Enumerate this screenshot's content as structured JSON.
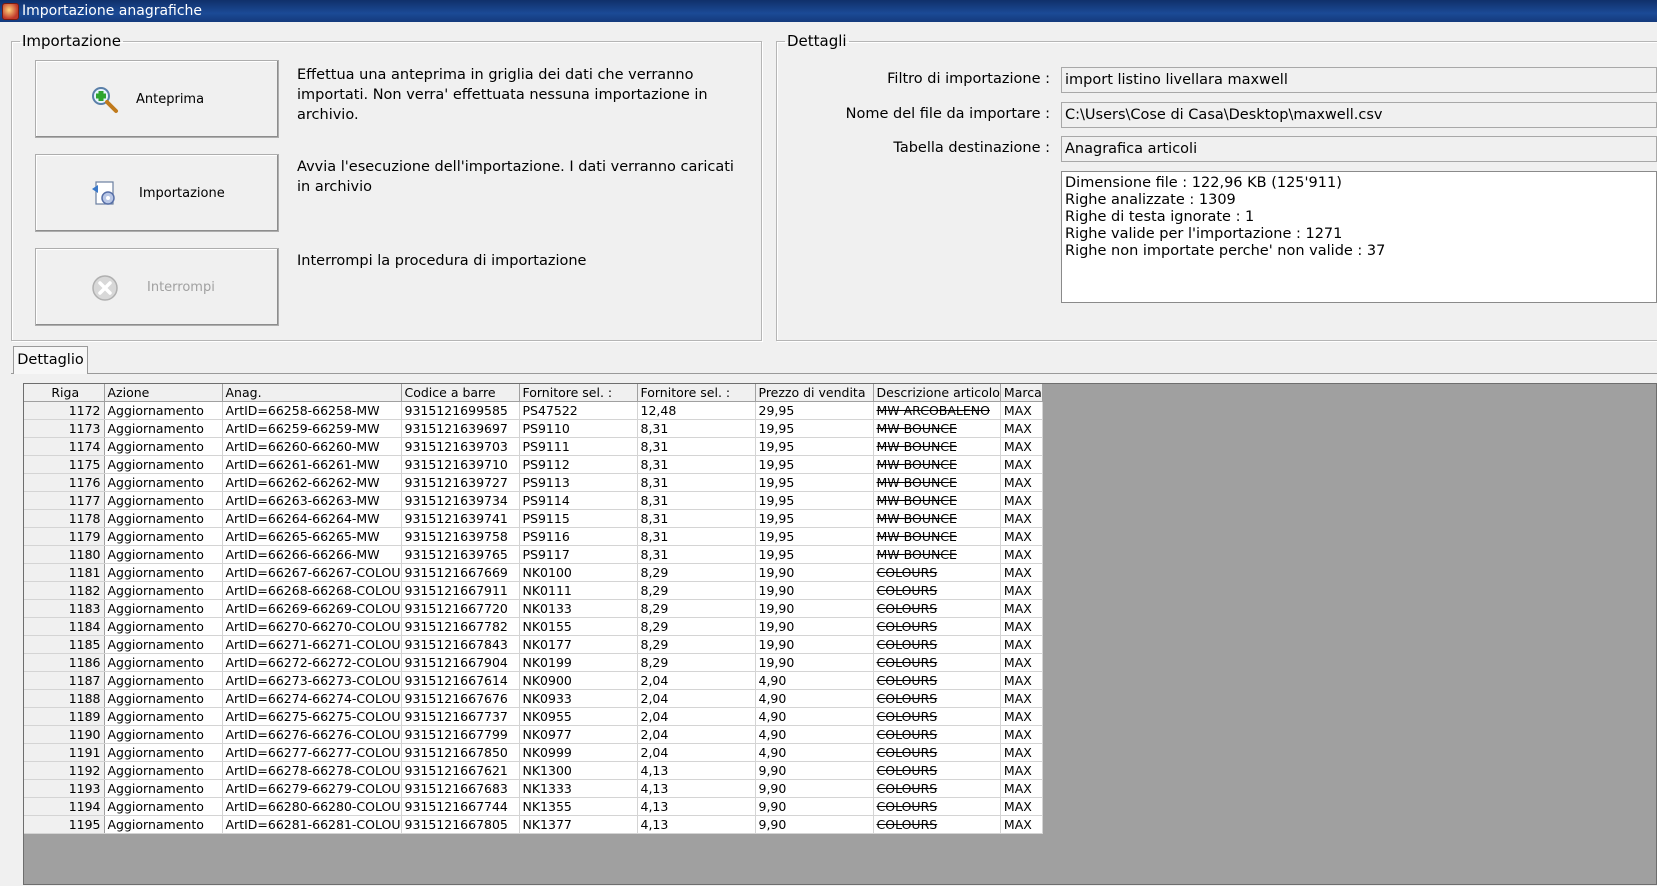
{
  "window": {
    "title": "Importazione anagrafiche"
  },
  "importazione": {
    "legend": "Importazione",
    "buttons": [
      {
        "label": "Anteprima",
        "icon": "magnifier-plus-icon",
        "enabled": true,
        "description": "Effettua una anteprima in griglia dei dati che verranno importati. Non verra' effettuata nessuna importazione in archivio."
      },
      {
        "label": "Importazione",
        "icon": "import-gear-icon",
        "enabled": true,
        "description": "Avvia l'esecuzione dell'importazione. I dati verranno caricati in archivio"
      },
      {
        "label": "Interrompi",
        "icon": "stop-x-icon",
        "enabled": false,
        "description": "Interrompi la procedura di importazione"
      }
    ]
  },
  "dettagli": {
    "legend": "Dettagli",
    "fields": [
      {
        "label": "Filtro di importazione :",
        "value": "import listino livellara maxwell"
      },
      {
        "label": "Nome del file da importare :",
        "value": "C:\\Users\\Cose di Casa\\Desktop\\maxwell.csv"
      },
      {
        "label": "Tabella destinazione :",
        "value": "Anagrafica articoli"
      }
    ],
    "info": [
      "Dimensione file : 122,96 KB (125'911)",
      "Righe analizzate : 1309",
      "Righe di testa ignorate : 1",
      "Righe valide per l'importazione : 1271",
      "Righe non importate perche' non valide : 37"
    ]
  },
  "tab": {
    "label": "Dettaglio"
  },
  "grid": {
    "columns": [
      "Riga",
      "Azione",
      "Anag.",
      "Codice a barre",
      "Fornitore sel. :",
      "Fornitore sel. :",
      "Prezzo di vendita",
      "Descrizione articolo",
      "Marca"
    ],
    "rows": [
      [
        "1172",
        "Aggiornamento",
        "ArtID=66258-66258-MW",
        "9315121699585",
        "PS47522",
        "12,48",
        "29,95",
        "MW ARCOBALENO",
        "MAX"
      ],
      [
        "1173",
        "Aggiornamento",
        "ArtID=66259-66259-MW",
        "9315121639697",
        "PS9110",
        "8,31",
        "19,95",
        "MW BOUNCE",
        "MAX"
      ],
      [
        "1174",
        "Aggiornamento",
        "ArtID=66260-66260-MW",
        "9315121639703",
        "PS9111",
        "8,31",
        "19,95",
        "MW BOUNCE",
        "MAX"
      ],
      [
        "1175",
        "Aggiornamento",
        "ArtID=66261-66261-MW",
        "9315121639710",
        "PS9112",
        "8,31",
        "19,95",
        "MW BOUNCE",
        "MAX"
      ],
      [
        "1176",
        "Aggiornamento",
        "ArtID=66262-66262-MW",
        "9315121639727",
        "PS9113",
        "8,31",
        "19,95",
        "MW BOUNCE",
        "MAX"
      ],
      [
        "1177",
        "Aggiornamento",
        "ArtID=66263-66263-MW",
        "9315121639734",
        "PS9114",
        "8,31",
        "19,95",
        "MW BOUNCE",
        "MAX"
      ],
      [
        "1178",
        "Aggiornamento",
        "ArtID=66264-66264-MW",
        "9315121639741",
        "PS9115",
        "8,31",
        "19,95",
        "MW BOUNCE",
        "MAX"
      ],
      [
        "1179",
        "Aggiornamento",
        "ArtID=66265-66265-MW",
        "9315121639758",
        "PS9116",
        "8,31",
        "19,95",
        "MW BOUNCE",
        "MAX"
      ],
      [
        "1180",
        "Aggiornamento",
        "ArtID=66266-66266-MW",
        "9315121639765",
        "PS9117",
        "8,31",
        "19,95",
        "MW BOUNCE",
        "MAX"
      ],
      [
        "1181",
        "Aggiornamento",
        "ArtID=66267-66267-COLOU",
        "9315121667669",
        "NK0100",
        "8,29",
        "19,90",
        "COLOURS",
        "MAX"
      ],
      [
        "1182",
        "Aggiornamento",
        "ArtID=66268-66268-COLOU",
        "9315121667911",
        "NK0111",
        "8,29",
        "19,90",
        "COLOURS",
        "MAX"
      ],
      [
        "1183",
        "Aggiornamento",
        "ArtID=66269-66269-COLOU",
        "9315121667720",
        "NK0133",
        "8,29",
        "19,90",
        "COLOURS",
        "MAX"
      ],
      [
        "1184",
        "Aggiornamento",
        "ArtID=66270-66270-COLOU",
        "9315121667782",
        "NK0155",
        "8,29",
        "19,90",
        "COLOURS",
        "MAX"
      ],
      [
        "1185",
        "Aggiornamento",
        "ArtID=66271-66271-COLOU",
        "9315121667843",
        "NK0177",
        "8,29",
        "19,90",
        "COLOURS",
        "MAX"
      ],
      [
        "1186",
        "Aggiornamento",
        "ArtID=66272-66272-COLOU",
        "9315121667904",
        "NK0199",
        "8,29",
        "19,90",
        "COLOURS",
        "MAX"
      ],
      [
        "1187",
        "Aggiornamento",
        "ArtID=66273-66273-COLOU",
        "9315121667614",
        "NK0900",
        "2,04",
        "4,90",
        "COLOURS",
        "MAX"
      ],
      [
        "1188",
        "Aggiornamento",
        "ArtID=66274-66274-COLOU",
        "9315121667676",
        "NK0933",
        "2,04",
        "4,90",
        "COLOURS",
        "MAX"
      ],
      [
        "1189",
        "Aggiornamento",
        "ArtID=66275-66275-COLOU",
        "9315121667737",
        "NK0955",
        "2,04",
        "4,90",
        "COLOURS",
        "MAX"
      ],
      [
        "1190",
        "Aggiornamento",
        "ArtID=66276-66276-COLOU",
        "9315121667799",
        "NK0977",
        "2,04",
        "4,90",
        "COLOURS",
        "MAX"
      ],
      [
        "1191",
        "Aggiornamento",
        "ArtID=66277-66277-COLOU",
        "9315121667850",
        "NK0999",
        "2,04",
        "4,90",
        "COLOURS",
        "MAX"
      ],
      [
        "1192",
        "Aggiornamento",
        "ArtID=66278-66278-COLOU",
        "9315121667621",
        "NK1300",
        "4,13",
        "9,90",
        "COLOURS",
        "MAX"
      ],
      [
        "1193",
        "Aggiornamento",
        "ArtID=66279-66279-COLOU",
        "9315121667683",
        "NK1333",
        "4,13",
        "9,90",
        "COLOURS",
        "MAX"
      ],
      [
        "1194",
        "Aggiornamento",
        "ArtID=66280-66280-COLOU",
        "9315121667744",
        "NK1355",
        "4,13",
        "9,90",
        "COLOURS",
        "MAX"
      ],
      [
        "1195",
        "Aggiornamento",
        "ArtID=66281-66281-COLOU",
        "9315121667805",
        "NK1377",
        "4,13",
        "9,90",
        "COLOURS",
        "MAX"
      ]
    ]
  }
}
